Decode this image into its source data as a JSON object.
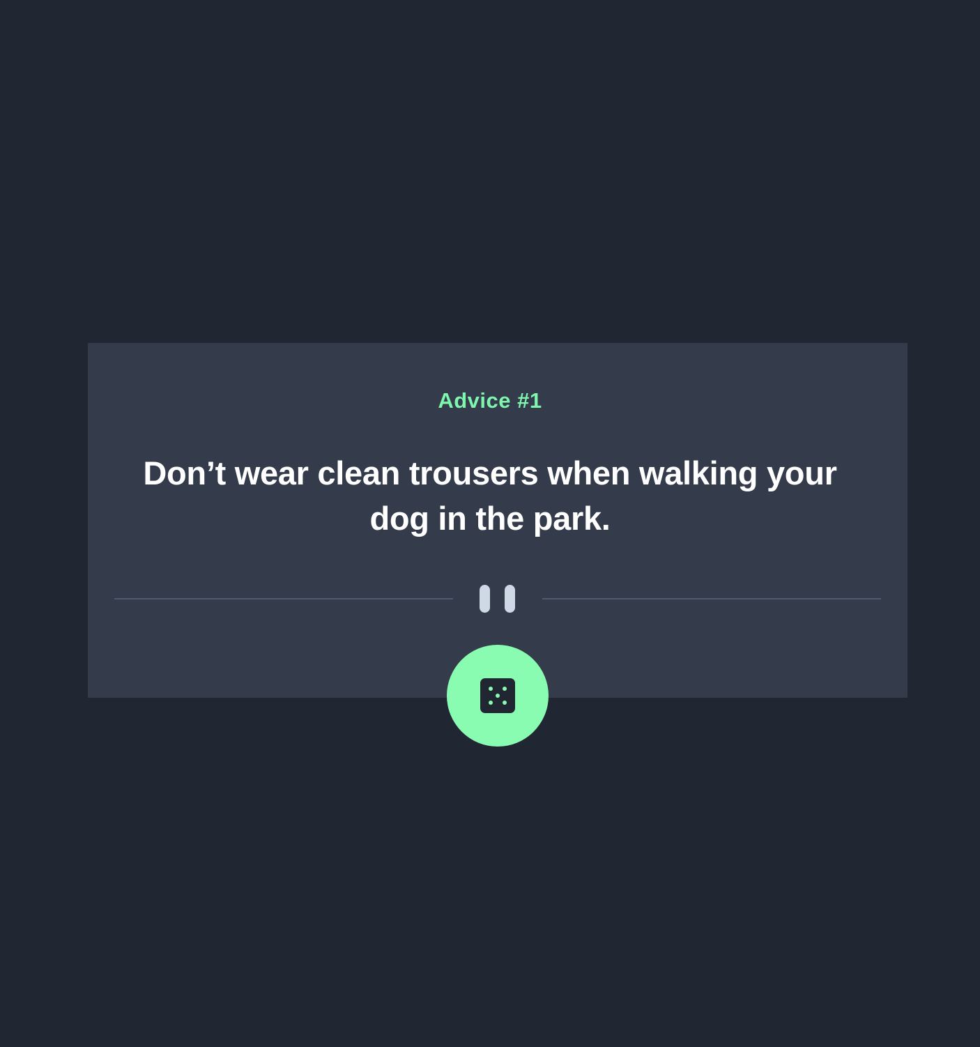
{
  "colors": {
    "page_background": "#202632",
    "card_background": "#343b4a",
    "accent": "#7ef6ad",
    "button_background": "#8afcb1",
    "divider": "#4e5a6d",
    "text_primary": "#ffffff",
    "pause_bars": "#cfd9e5"
  },
  "card": {
    "advice_id_label": "Advice #1",
    "advice_text": "Don’t wear clean trousers when walking your dog in the park."
  },
  "icons": {
    "divider_icon": "pause-icon",
    "button_icon": "dice-icon"
  }
}
